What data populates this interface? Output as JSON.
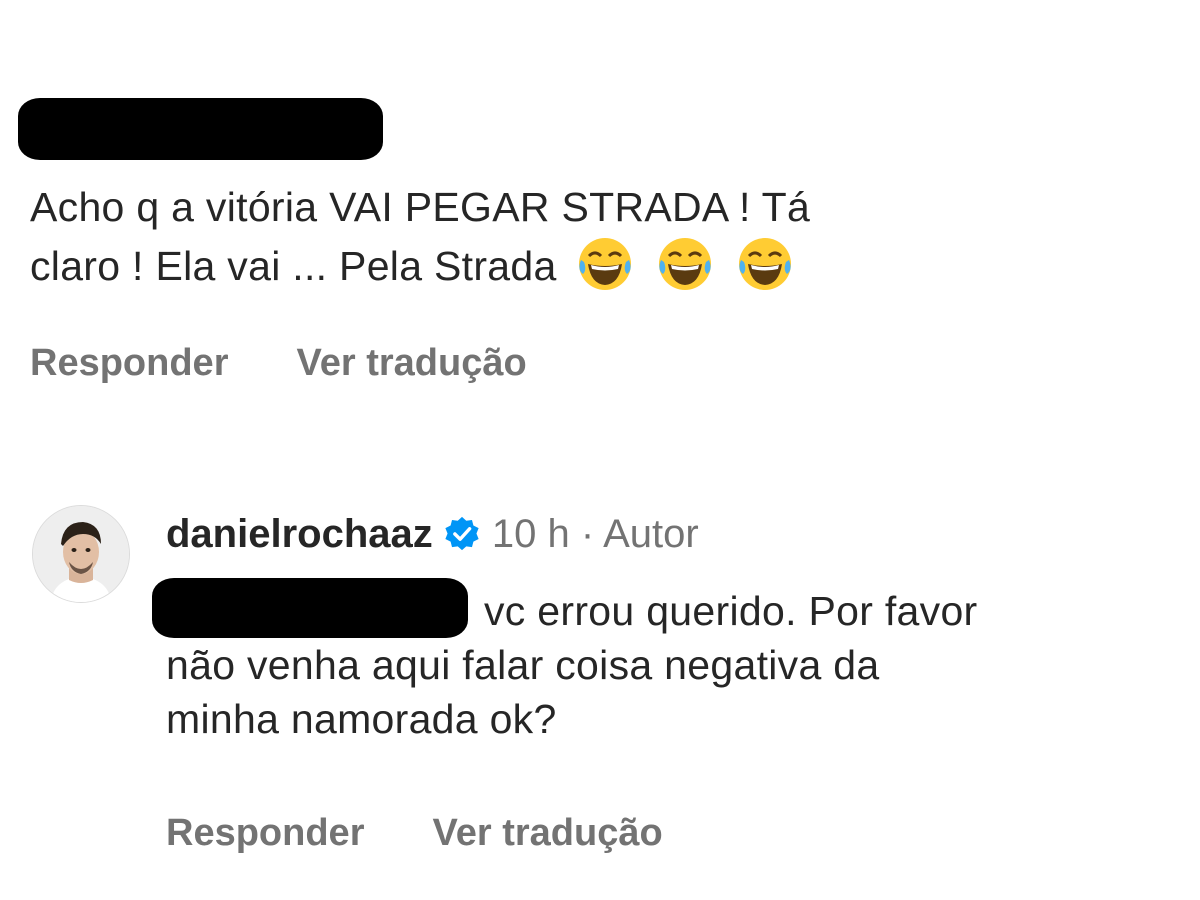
{
  "comment1": {
    "text_line1": "Acho q a vitória VAI PEGAR STRADA ! Tá",
    "text_line2": "claro ! Ela vai ... Pela Strada",
    "emojis": [
      "face-with-tears-of-joy-icon",
      "face-with-tears-of-joy-icon",
      "face-with-tears-of-joy-icon"
    ],
    "actions": {
      "reply": "Responder",
      "translate": "Ver tradução"
    }
  },
  "comment2": {
    "username": "danielrochaaz",
    "verified_icon": "verified-badge-icon",
    "time": "10 h",
    "separator": "·",
    "author_label": "Autor",
    "text_line1": "vc errou querido. Por favor",
    "text_line2": "não venha aqui falar coisa negativa da",
    "text_line3": "minha namorada ok?",
    "actions": {
      "reply": "Responder",
      "translate": "Ver tradução"
    }
  },
  "colors": {
    "text": "#262626",
    "secondary": "#737373",
    "verified": "#0095f6",
    "redaction": "#000000"
  }
}
